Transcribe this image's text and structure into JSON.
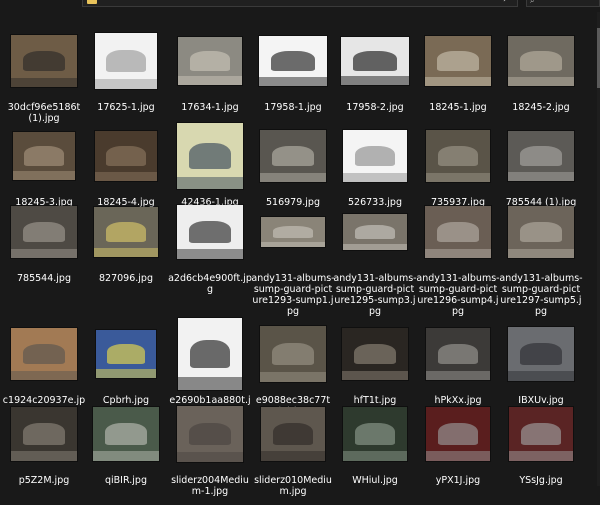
{
  "explorer": {
    "files": [
      {
        "name": "30dcf96e5186t(1).jpg",
        "bg": "#6e5c46",
        "fg": "#2c2a28"
      },
      {
        "name": "17625-1.jpg",
        "bg": "#f2f2f2",
        "fg": "#9a9a9a"
      },
      {
        "name": "17634-1.jpg",
        "bg": "#8c8a82",
        "fg": "#c9c4b8"
      },
      {
        "name": "17958-1.jpg",
        "bg": "#f4f4f4",
        "fg": "#222222"
      },
      {
        "name": "17958-2.jpg",
        "bg": "#e6e6e6",
        "fg": "#1a1a1a"
      },
      {
        "name": "18245-1.jpg",
        "bg": "#7a6a55",
        "fg": "#c8bfae"
      },
      {
        "name": "18245-2.jpg",
        "bg": "#6f6a60",
        "fg": "#b8b0a2"
      },
      {
        "name": "18245-3.jpg",
        "bg": "#5a4c3c",
        "fg": "#a6947c"
      },
      {
        "name": "18245-4.jpg",
        "bg": "#4a3b2d",
        "fg": "#8a7660"
      },
      {
        "name": "42436-1.jpg",
        "bg": "#d8d8b0",
        "fg": "#3a4a5a"
      },
      {
        "name": "516979.jpg",
        "bg": "#595650",
        "fg": "#b4b0a6"
      },
      {
        "name": "526733.jpg",
        "bg": "#f4f4f4",
        "fg": "#8e8e8e"
      },
      {
        "name": "735937.jpg",
        "bg": "#5a5448",
        "fg": "#9c9688"
      },
      {
        "name": "785544 (1).jpg",
        "bg": "#5c5a56",
        "fg": "#a8a6a2"
      },
      {
        "name": "785544.jpg",
        "bg": "#4e4a44",
        "fg": "#9e9890"
      },
      {
        "name": "827096.jpg",
        "bg": "#6a6658",
        "fg": "#d8c86a"
      },
      {
        "name": "a2d6cb4e900ft.jpg",
        "bg": "#eeeeee",
        "fg": "#2a2a2a"
      },
      {
        "name": "andy131-albums-sump-guard-picture1293-sump1.jpg",
        "bg": "#8a8478",
        "fg": "#c6c2b8"
      },
      {
        "name": "andy131-albums-sump-guard-picture1295-sump3.jpg",
        "bg": "#7a746a",
        "fg": "#cac6be"
      },
      {
        "name": "andy131-albums-sump-guard-picture1296-sump4.jpg",
        "bg": "#6a5e54",
        "fg": "#b4aca4"
      },
      {
        "name": "andy131-albums-sump-guard-picture1297-sump5.jpg",
        "bg": "#6c645a",
        "fg": "#b2aba0"
      },
      {
        "name": "c1924c20937e.jpg",
        "bg": "#a27a54",
        "fg": "#5a5650"
      },
      {
        "name": "Cpbrh.jpg",
        "bg": "#3a5a9a",
        "fg": "#e8d84a"
      },
      {
        "name": "e2690b1aa880t.jpg",
        "bg": "#f2f2f2",
        "fg": "#1e1e1e"
      },
      {
        "name": "e9088ec38c77t(1).jpg",
        "bg": "#5a5448",
        "fg": "#9a9486"
      },
      {
        "name": "hfT1t.jpg",
        "bg": "#2a2622",
        "fg": "#8e8478"
      },
      {
        "name": "hPkXx.jpg",
        "bg": "#3c3a38",
        "fg": "#9a9894"
      },
      {
        "name": "IBXUv.jpg",
        "bg": "#6a6c70",
        "fg": "#2c2e32"
      },
      {
        "name": "p5Z2M.jpg",
        "bg": "#3a3630",
        "fg": "#8a847a"
      },
      {
        "name": "qiBIR.jpg",
        "bg": "#4a5a4a",
        "fg": "#b8bcb2"
      },
      {
        "name": "sliderz004Medium-1.jpg",
        "bg": "#6a625a",
        "fg": "#4a4440"
      },
      {
        "name": "sliderz010Medium.jpg",
        "bg": "#5e574e",
        "fg": "#2e2a26"
      },
      {
        "name": "WHiul.jpg",
        "bg": "#2e3a2e",
        "fg": "#8c9a8c"
      },
      {
        "name": "yPX1J.jpg",
        "bg": "#5a1e1e",
        "fg": "#9a9a9a"
      },
      {
        "name": "YSsJg.jpg",
        "bg": "#5a2424",
        "fg": "#a0a0a0"
      }
    ]
  }
}
